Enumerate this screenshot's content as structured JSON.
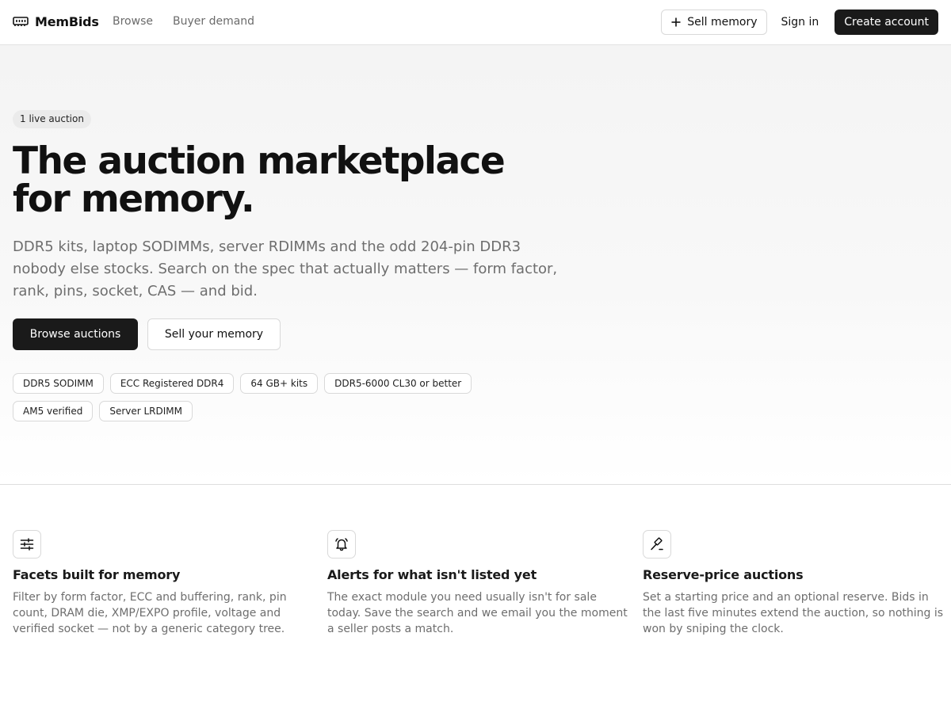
{
  "nav": {
    "brand": "MemBids",
    "links": [
      "Browse",
      "Buyer demand"
    ],
    "sell_label": "Sell memory",
    "signin_label": "Sign in",
    "create_label": "Create account"
  },
  "hero": {
    "badge": "1 live auction",
    "headline_line1": "The auction marketplace",
    "headline_line2": "for memory.",
    "subtext": "DDR5 kits, laptop SODIMMs, server RDIMMs and the odd 204-pin DDR3 nobody else stocks. Search on the spec that actually matters — form factor, rank, pins, socket, CAS — and bid.",
    "primary_button": "Browse auctions",
    "secondary_button": "Sell your memory",
    "chips": [
      "DDR5 SODIMM",
      "ECC Registered DDR4",
      "64 GB+ kits",
      "DDR5-6000 CL30 or better",
      "AM5 verified",
      "Server LRDIMM"
    ]
  },
  "features": [
    {
      "icon": "sliders-icon",
      "title": "Facets built for memory",
      "description": "Filter by form factor, ECC and buffering, rank, pin count, DRAM die, XMP/EXPO profile, voltage and verified socket — not by a generic category tree."
    },
    {
      "icon": "bell-icon",
      "title": "Alerts for what isn't listed yet",
      "description": "The exact module you need usually isn't for sale today. Save the search and we email you the moment a seller posts a match."
    },
    {
      "icon": "gavel-icon",
      "title": "Reserve-price auctions",
      "description": "Set a starting price and an optional reserve. Bids in the last five minutes extend the auction, so nothing is won by sniping the clock."
    }
  ]
}
